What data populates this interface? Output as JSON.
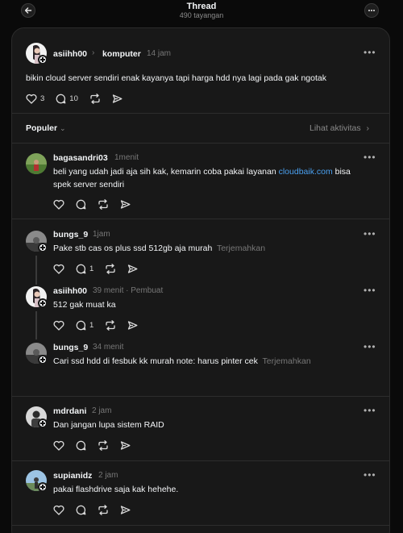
{
  "header": {
    "title": "Thread",
    "views": "490 tayangan"
  },
  "main_post": {
    "username": "asiihh00",
    "community": "komputer",
    "time": "14 jam",
    "text": "bikin cloud server sendiri enak kayanya tapi harga hdd nya lagi pada gak ngotak",
    "likes": "3",
    "comments": "10"
  },
  "sort": {
    "label": "Populer",
    "activity_label": "Lihat aktivitas"
  },
  "replies": [
    {
      "username": "bagasandri03",
      "time": "1menit",
      "text_line1_before": "beli yang udah jadi aja sih kak, kemarin coba pakai layanan ",
      "link": "cloudbaik.com",
      "text_line1_after": " bisa",
      "text_line2": "spek server sendiri"
    },
    {
      "username": "bungs_9",
      "time": "1jam",
      "text": "Pake stb cas os plus ssd 512gb aja murah",
      "translate": "Terjemahkan",
      "comments": "1"
    },
    {
      "username": "asiihh00",
      "time": "39 menit",
      "author_label": "· Pembuat",
      "text": "512 gak muat ka",
      "comments": "1"
    },
    {
      "username": "bungs_9",
      "time": "34 menit",
      "text": "Cari ssd hdd di fesbuk kk murah note: harus pinter cek",
      "translate": "Terjemahkan"
    },
    {
      "username": "mdrdani",
      "time": "2 jam",
      "text": "Dan jangan lupa sistem RAID"
    },
    {
      "username": "supianidz",
      "time": "2 jam",
      "text": "pakai flashdrive saja kak hehehe."
    }
  ]
}
